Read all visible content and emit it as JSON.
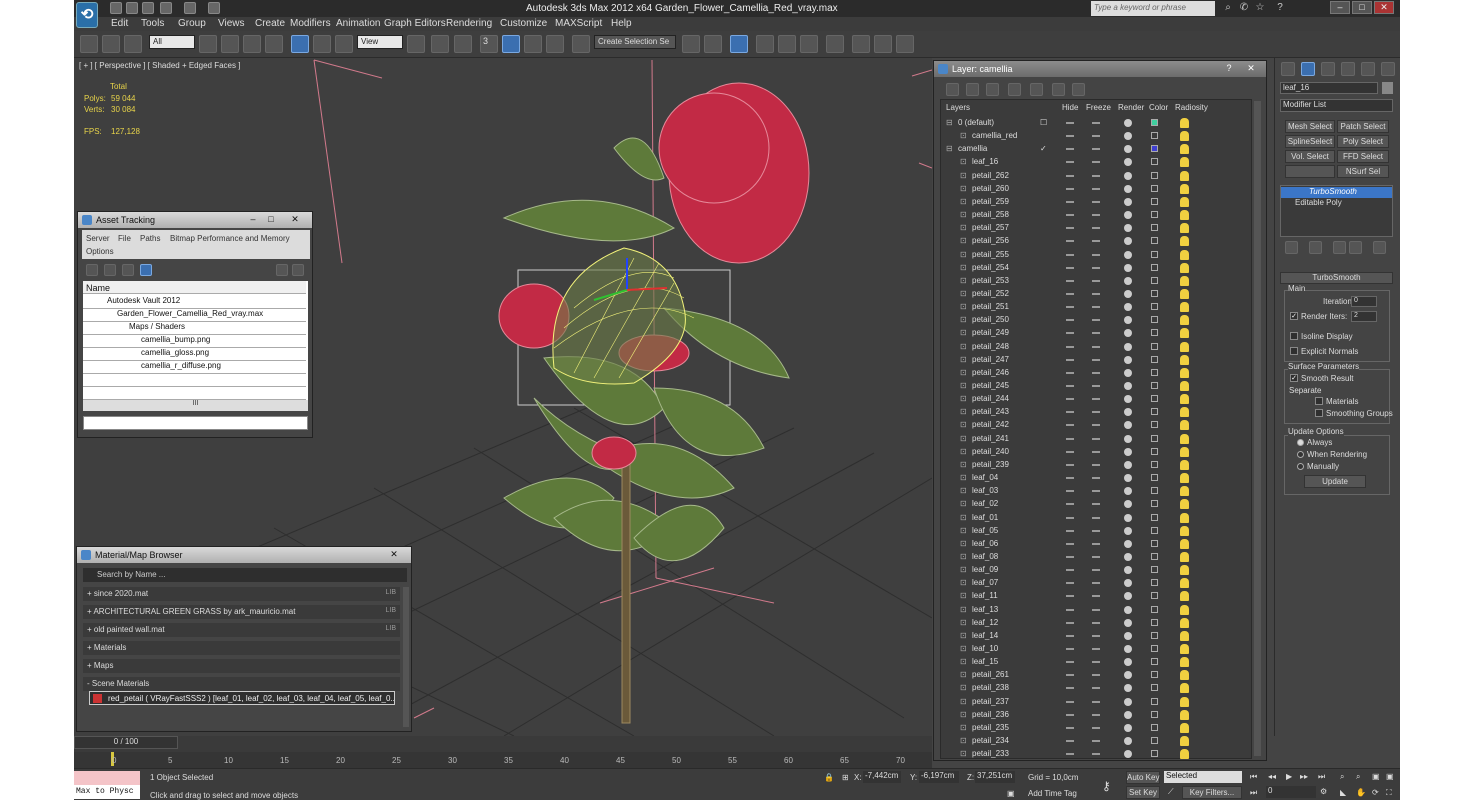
{
  "titlebar": {
    "title": "Autodesk 3ds Max  2012 x64      Garden_Flower_Camellia_Red_vray.max",
    "search_placeholder": "Type a keyword or phrase"
  },
  "menus": [
    "Edit",
    "Tools",
    "Group",
    "Views",
    "Create",
    "Modifiers",
    "Animation",
    "Graph Editors",
    "Rendering",
    "Customize",
    "MAXScript",
    "Help"
  ],
  "toolbar": {
    "filter": "All",
    "ref_coord": "View",
    "selection_set": "Create Selection Se",
    "angle_snap": "3"
  },
  "viewport": {
    "label": "[ + ] [ Perspective ] [ Shaded + Edged Faces ]",
    "stats": {
      "header": "Total",
      "polys_label": "Polys:",
      "polys": "59 044",
      "verts_label": "Verts:",
      "verts": "30 084",
      "fps_label": "FPS:",
      "fps": "127,128"
    }
  },
  "asset_tracking": {
    "title": "Asset Tracking",
    "menu": [
      "Server",
      "File",
      "Paths",
      "Bitmap Performance and Memory",
      "Options"
    ],
    "column": "Name",
    "rows": [
      "Autodesk Vault 2012",
      "Garden_Flower_Camellia_Red_vray.max",
      "Maps / Shaders",
      "camellia_bump.png",
      "camellia_gloss.png",
      "camellia_r_diffuse.png"
    ],
    "scroll_label": "III"
  },
  "material_browser": {
    "title": "Material/Map Browser",
    "search_placeholder": "Search by Name ...",
    "rows": [
      {
        "label": "+ since 2020.mat",
        "lib": "LIB"
      },
      {
        "label": "+ ARCHITECTURAL GREEN GRASS by ark_mauricio.mat",
        "lib": "LIB"
      },
      {
        "label": "+ old painted wall.mat",
        "lib": "LIB"
      },
      {
        "label": "+ Materials",
        "lib": ""
      },
      {
        "label": "+ Maps",
        "lib": ""
      },
      {
        "label": "- Scene Materials",
        "lib": ""
      }
    ],
    "scene_material": "red_petail  ( VRayFastSSS2 ) [leaf_01, leaf_02, leaf_03, leaf_04, leaf_05, leaf_0..."
  },
  "layer_manager": {
    "title": "Layer: camellia",
    "columns": [
      "Layers",
      "Hide",
      "Freeze",
      "Render",
      "Color",
      "Radiosity"
    ],
    "rows": [
      {
        "name": "0 (default)",
        "level": 0,
        "color": "#3fcf9f",
        "mark": "☐"
      },
      {
        "name": "camellia_red",
        "level": 1,
        "color": "",
        "mark": ""
      },
      {
        "name": "camellia",
        "level": 0,
        "color": "#4040d0",
        "mark": "✓"
      },
      {
        "name": "leaf_16",
        "level": 1,
        "color": "",
        "mark": ""
      },
      {
        "name": "petail_262",
        "level": 1,
        "color": "",
        "mark": ""
      },
      {
        "name": "petail_260",
        "level": 1,
        "color": "",
        "mark": ""
      },
      {
        "name": "petail_259",
        "level": 1,
        "color": "",
        "mark": ""
      },
      {
        "name": "petail_258",
        "level": 1,
        "color": "",
        "mark": ""
      },
      {
        "name": "petail_257",
        "level": 1,
        "color": "",
        "mark": ""
      },
      {
        "name": "petail_256",
        "level": 1,
        "color": "",
        "mark": ""
      },
      {
        "name": "petail_255",
        "level": 1,
        "color": "",
        "mark": ""
      },
      {
        "name": "petail_254",
        "level": 1,
        "color": "",
        "mark": ""
      },
      {
        "name": "petail_253",
        "level": 1,
        "color": "",
        "mark": ""
      },
      {
        "name": "petail_252",
        "level": 1,
        "color": "",
        "mark": ""
      },
      {
        "name": "petail_251",
        "level": 1,
        "color": "",
        "mark": ""
      },
      {
        "name": "petail_250",
        "level": 1,
        "color": "",
        "mark": ""
      },
      {
        "name": "petail_249",
        "level": 1,
        "color": "",
        "mark": ""
      },
      {
        "name": "petail_248",
        "level": 1,
        "color": "",
        "mark": ""
      },
      {
        "name": "petail_247",
        "level": 1,
        "color": "",
        "mark": ""
      },
      {
        "name": "petail_246",
        "level": 1,
        "color": "",
        "mark": ""
      },
      {
        "name": "petail_245",
        "level": 1,
        "color": "",
        "mark": ""
      },
      {
        "name": "petail_244",
        "level": 1,
        "color": "",
        "mark": ""
      },
      {
        "name": "petail_243",
        "level": 1,
        "color": "",
        "mark": ""
      },
      {
        "name": "petail_242",
        "level": 1,
        "color": "",
        "mark": ""
      },
      {
        "name": "petail_241",
        "level": 1,
        "color": "",
        "mark": ""
      },
      {
        "name": "petail_240",
        "level": 1,
        "color": "",
        "mark": ""
      },
      {
        "name": "petail_239",
        "level": 1,
        "color": "",
        "mark": ""
      },
      {
        "name": "leaf_04",
        "level": 1,
        "color": "",
        "mark": ""
      },
      {
        "name": "leaf_03",
        "level": 1,
        "color": "",
        "mark": ""
      },
      {
        "name": "leaf_02",
        "level": 1,
        "color": "",
        "mark": ""
      },
      {
        "name": "leaf_01",
        "level": 1,
        "color": "",
        "mark": ""
      },
      {
        "name": "leaf_05",
        "level": 1,
        "color": "",
        "mark": ""
      },
      {
        "name": "leaf_06",
        "level": 1,
        "color": "",
        "mark": ""
      },
      {
        "name": "leaf_08",
        "level": 1,
        "color": "",
        "mark": ""
      },
      {
        "name": "leaf_09",
        "level": 1,
        "color": "",
        "mark": ""
      },
      {
        "name": "leaf_07",
        "level": 1,
        "color": "",
        "mark": ""
      },
      {
        "name": "leaf_11",
        "level": 1,
        "color": "",
        "mark": ""
      },
      {
        "name": "leaf_13",
        "level": 1,
        "color": "",
        "mark": ""
      },
      {
        "name": "leaf_12",
        "level": 1,
        "color": "",
        "mark": ""
      },
      {
        "name": "leaf_14",
        "level": 1,
        "color": "",
        "mark": ""
      },
      {
        "name": "leaf_10",
        "level": 1,
        "color": "",
        "mark": ""
      },
      {
        "name": "leaf_15",
        "level": 1,
        "color": "",
        "mark": ""
      },
      {
        "name": "petail_261",
        "level": 1,
        "color": "",
        "mark": ""
      },
      {
        "name": "petail_238",
        "level": 1,
        "color": "",
        "mark": ""
      },
      {
        "name": "petail_237",
        "level": 1,
        "color": "",
        "mark": ""
      },
      {
        "name": "petail_236",
        "level": 1,
        "color": "",
        "mark": ""
      },
      {
        "name": "petail_235",
        "level": 1,
        "color": "",
        "mark": ""
      },
      {
        "name": "petail_234",
        "level": 1,
        "color": "",
        "mark": ""
      },
      {
        "name": "petail_233",
        "level": 1,
        "color": "",
        "mark": ""
      }
    ]
  },
  "command_panel": {
    "object_name": "leaf_16",
    "modifier_list": "Modifier List",
    "sel_buttons": [
      "Mesh Select",
      "Patch Select",
      "SplineSelect",
      "Poly Select",
      "Vol. Select",
      "FFD Select",
      "",
      "NSurf Sel"
    ],
    "stack": [
      "TurboSmooth",
      "Editable Poly"
    ],
    "rollout": "TurboSmooth",
    "main_group": "Main",
    "iterations_label": "Iterations:",
    "iterations": "0",
    "render_iters_label": "Render Iters:",
    "render_iters": "2",
    "isoline": "Isoline Display",
    "explicit": "Explicit Normals",
    "surface_group": "Surface Parameters",
    "smooth_result": "Smooth Result",
    "separate": "Separate",
    "materials": "Materials",
    "smoothing_groups": "Smoothing Groups",
    "update_group": "Update Options",
    "always": "Always",
    "when_rendering": "When Rendering",
    "manually": "Manually",
    "update_btn": "Update"
  },
  "timeslider": {
    "frame": "0 / 100",
    "ticks": [
      "0",
      "5",
      "10",
      "15",
      "20",
      "25",
      "30",
      "35",
      "40",
      "45",
      "50",
      "55",
      "60",
      "65",
      "70"
    ]
  },
  "status": {
    "maxscript": "Max to Physc",
    "selected": "1 Object Selected",
    "prompt": "Click and drag to select and move objects",
    "x_label": "X:",
    "x": "-7,442cm",
    "y_label": "Y:",
    "y": "-6,197cm",
    "z_label": "Z:",
    "z": "37,251cm",
    "grid": "Grid = 10,0cm",
    "add_time_tag": "Add Time Tag",
    "auto_key": "Auto Key",
    "set_key": "Set Key",
    "key_mode": "Selected",
    "key_filters": "Key Filters...",
    "frame": "0"
  }
}
